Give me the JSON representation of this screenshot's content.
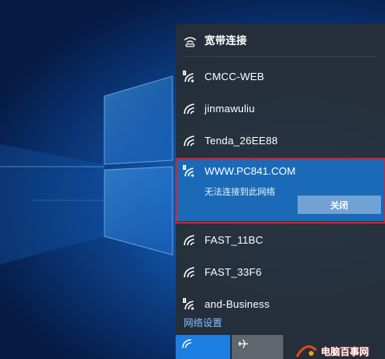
{
  "flyout": {
    "broadband": {
      "label": "宽带连接",
      "icon": "dialup-icon"
    },
    "networks": [
      {
        "name": "CMCC-WEB",
        "icon": "wifi-unsecured-icon",
        "secured": false
      },
      {
        "name": "jinmawuliu",
        "icon": "wifi-icon",
        "secured": true
      },
      {
        "name": "Tenda_26EE88",
        "icon": "wifi-icon",
        "secured": true
      }
    ],
    "selected": {
      "name": "WWW.PC841.COM",
      "status": "无法连接到此网络",
      "button_label": "关闭",
      "icon": "wifi-unsecured-icon"
    },
    "networks_after": [
      {
        "name": "FAST_11BC",
        "icon": "wifi-icon",
        "secured": true
      },
      {
        "name": "FAST_33F6",
        "icon": "wifi-icon",
        "secured": true
      },
      {
        "name": "and-Business",
        "icon": "wifi-unsecured-icon",
        "secured": false
      }
    ],
    "settings_link": "网络设置",
    "quick_actions": [
      {
        "name": "wifi-toggle",
        "icon": "wifi-icon",
        "active": true
      },
      {
        "name": "airplane-mode",
        "icon": "airplane-icon",
        "active": false
      }
    ]
  },
  "watermark": {
    "text": "电脑百事网"
  },
  "colors": {
    "flyout_bg": "#282e36",
    "selected_bg": "#1a6ab8",
    "highlight_border": "#d8232a",
    "link": "#7fc0ff",
    "tile_active": "#1c7ee0"
  }
}
